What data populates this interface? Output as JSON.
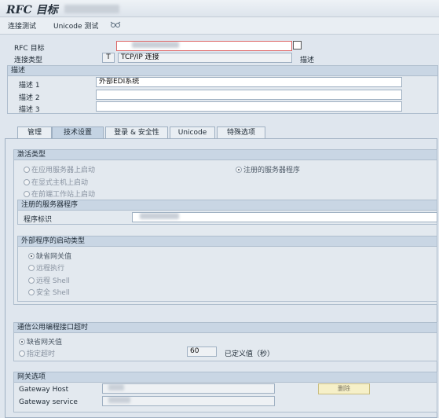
{
  "window": {
    "title": "RFC 目标"
  },
  "toolbar": {
    "connection_test": "连接测试",
    "unicode_test": "Unicode 测试"
  },
  "header": {
    "rfc_dest_label": "RFC 目标",
    "conn_type_label": "连接类型",
    "conn_type_code": "T",
    "conn_type_text": "TCP/IP 连接",
    "describe_label": "描述"
  },
  "description": {
    "heading": "描述",
    "rows": [
      {
        "label": "描述 1",
        "value": "外部EDI系统"
      },
      {
        "label": "描述 2",
        "value": ""
      },
      {
        "label": "描述 3",
        "value": ""
      }
    ]
  },
  "tabs": [
    {
      "label": "管理",
      "active": false
    },
    {
      "label": "技术设置",
      "active": true
    },
    {
      "label": "登录 & 安全性",
      "active": false
    },
    {
      "label": "Unicode",
      "active": false
    },
    {
      "label": "特殊选项",
      "active": false
    }
  ],
  "activation": {
    "heading": "激活类型",
    "options": [
      {
        "label": "在应用服务器上启动",
        "selected": false
      },
      {
        "label": "在显式主机上启动",
        "selected": false
      },
      {
        "label": "在前端工作站上启动",
        "selected": false
      },
      {
        "label": "注册的服务器程序",
        "selected": true
      }
    ]
  },
  "registered": {
    "heading": "注册的服务器程序",
    "program_id_label": "程序标识"
  },
  "ext_start": {
    "heading": "外部程序的启动类型",
    "options": [
      {
        "label": "缺省网关值",
        "selected": true
      },
      {
        "label": "远程执行",
        "selected": false
      },
      {
        "label": "远程 Shell",
        "selected": false
      },
      {
        "label": "安全 Shell",
        "selected": false
      }
    ]
  },
  "cpic": {
    "heading": "通信公用编程接口超时",
    "default_label": "缺省网关值",
    "specify_label": "指定超时",
    "timeout_value": "60",
    "defined_label": "已定义值（秒）"
  },
  "gateway": {
    "heading": "网关选项",
    "host_label": "Gateway Host",
    "service_label": "Gateway service",
    "delete_button": "删除"
  }
}
